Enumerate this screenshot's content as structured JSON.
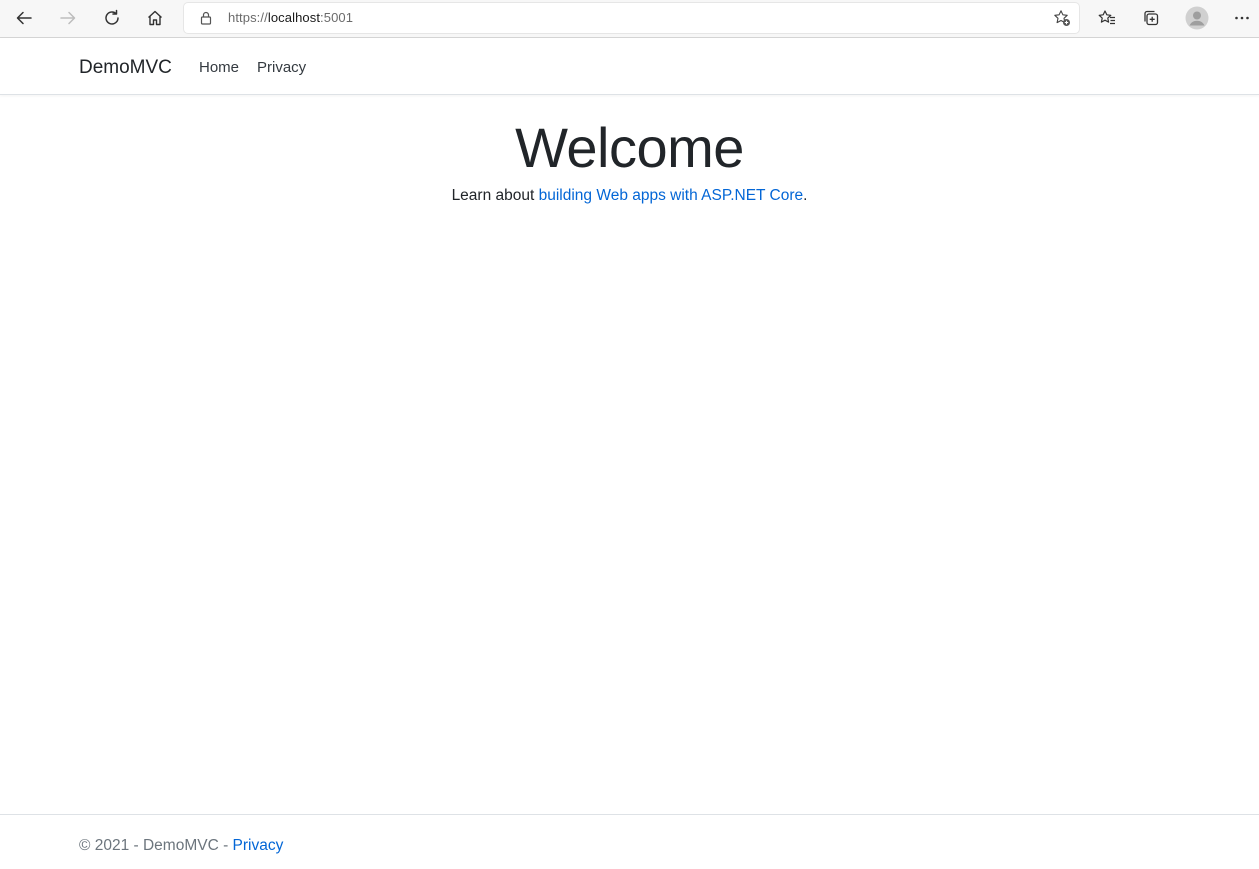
{
  "browser": {
    "url_scheme": "https://",
    "url_host": "localhost",
    "url_port": ":5001",
    "icons": [
      "back-arrow-icon",
      "forward-arrow-icon",
      "refresh-icon",
      "home-icon",
      "lock-icon",
      "add-favorite-icon",
      "favorites-icon",
      "collections-icon",
      "profile-avatar-icon",
      "more-options-icon"
    ]
  },
  "navbar": {
    "brand": "DemoMVC",
    "links": [
      {
        "label": "Home"
      },
      {
        "label": "Privacy"
      }
    ]
  },
  "main": {
    "heading": "Welcome",
    "lead_prefix": "Learn about ",
    "lead_link": "building Web apps with ASP.NET Core",
    "lead_suffix": "."
  },
  "footer": {
    "copyright": "© 2021 - DemoMVC - ",
    "privacy_link": "Privacy"
  },
  "colors": {
    "link": "#0366d6",
    "text": "#212529",
    "muted": "#6c757d"
  }
}
